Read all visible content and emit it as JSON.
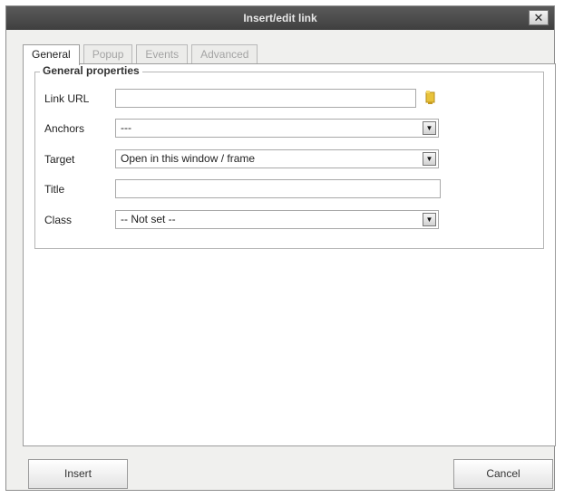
{
  "window": {
    "title": "Insert/edit link",
    "close_label": "✕"
  },
  "tabs": [
    {
      "label": "General",
      "active": true
    },
    {
      "label": "Popup",
      "active": false
    },
    {
      "label": "Events",
      "active": false
    },
    {
      "label": "Advanced",
      "active": false
    }
  ],
  "general": {
    "legend": "General properties",
    "link_url": {
      "label": "Link URL",
      "value": ""
    },
    "anchors": {
      "label": "Anchors",
      "value": "---"
    },
    "target": {
      "label": "Target",
      "value": "Open in this window / frame"
    },
    "title": {
      "label": "Title",
      "value": ""
    },
    "class": {
      "label": "Class",
      "value": "-- Not set --"
    }
  },
  "buttons": {
    "insert": "Insert",
    "cancel": "Cancel"
  },
  "icons": {
    "browse": "folder-browse-icon",
    "dropdown": "chevron-down-icon",
    "close": "close-icon"
  },
  "colors": {
    "titlebar": "#4a4a4a",
    "browse_icon": "#e8c23a"
  }
}
